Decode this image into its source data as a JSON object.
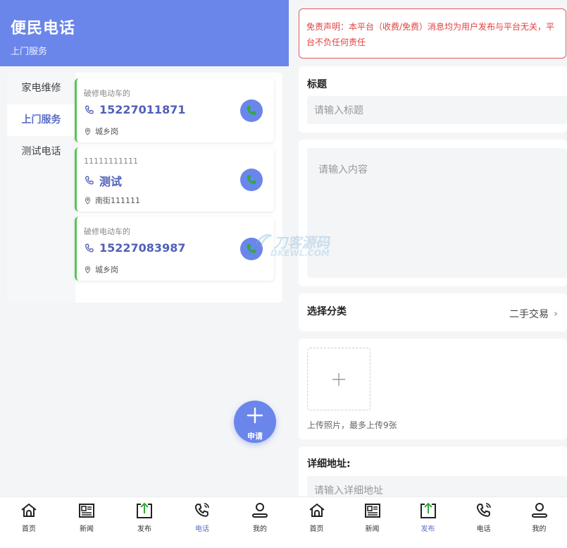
{
  "left": {
    "header": {
      "title": "便民电话",
      "subtitle": "上门服务"
    },
    "categories": [
      {
        "label": "家电维修",
        "active": false
      },
      {
        "label": "上门服务",
        "active": true
      },
      {
        "label": "测试电话",
        "active": false
      }
    ],
    "cards": [
      {
        "subtitle": "破修电动车的",
        "main": "15227011871",
        "address": "城乡岗"
      },
      {
        "subtitle": "11111111111",
        "main": "测试",
        "address": "南街111111"
      },
      {
        "subtitle": "破修电动车的",
        "main": "15227083987",
        "address": "城乡岗"
      }
    ],
    "fab_label": "申请",
    "tabs": [
      {
        "label": "首页",
        "icon": "home-icon",
        "active": false
      },
      {
        "label": "新闻",
        "icon": "news-icon",
        "active": false
      },
      {
        "label": "发布",
        "icon": "publish-icon",
        "active": false
      },
      {
        "label": "电话",
        "icon": "phone-icon",
        "active": true
      },
      {
        "label": "我的",
        "icon": "user-icon",
        "active": false
      }
    ]
  },
  "right": {
    "disclaimer": "免责声明：本平台（收费/免费）消息均为用户发布与平台无关，平台不负任何责任",
    "title_label": "标题",
    "title_placeholder": "请输入标题",
    "content_placeholder": "请输入内容",
    "category_label": "选择分类",
    "category_value": "二手交易",
    "upload_hint": "上传照片，最多上传9张",
    "address_label": "详细地址:",
    "address_placeholder": "请输入详细地址",
    "tabs": [
      {
        "label": "首页",
        "icon": "home-icon",
        "active": false
      },
      {
        "label": "新闻",
        "icon": "news-icon",
        "active": false
      },
      {
        "label": "发布",
        "icon": "publish-icon",
        "active": true
      },
      {
        "label": "电话",
        "icon": "phone-icon",
        "active": false
      },
      {
        "label": "我的",
        "icon": "user-icon",
        "active": false
      }
    ]
  },
  "watermark": {
    "text": "刀客源码",
    "sub": "DKEWL.COM"
  },
  "colors": {
    "accent": "#6a86ea",
    "accent_text": "#5b6fc4",
    "card_border": "#57c457",
    "call_icon": "#2eaa3a",
    "disclaimer": "#e04040"
  }
}
